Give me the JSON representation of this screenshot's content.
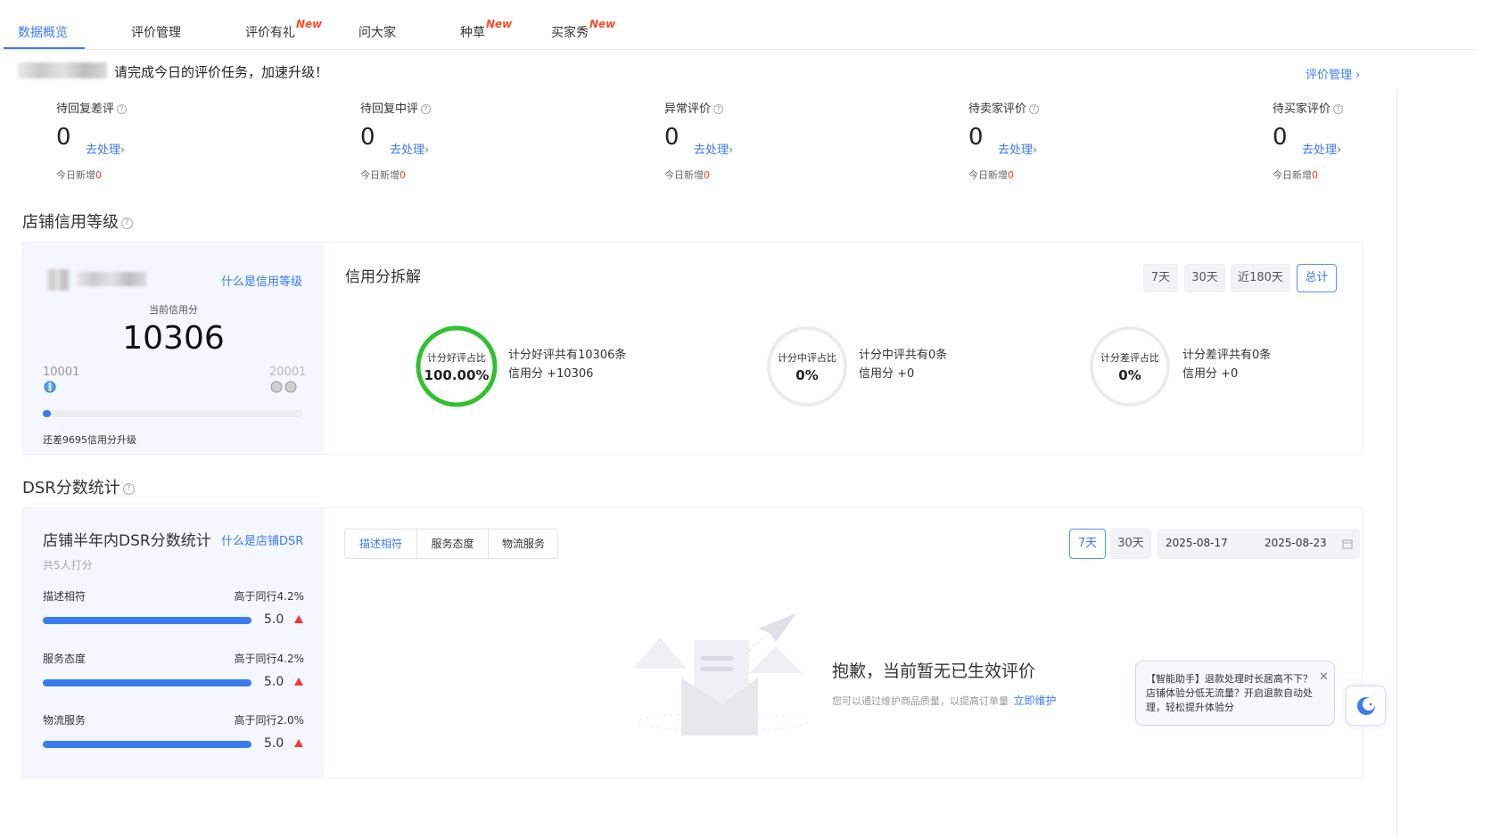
{
  "tabs": [
    {
      "label": "数据概览",
      "new": ""
    },
    {
      "label": "评价管理",
      "new": ""
    },
    {
      "label": "评价有礼",
      "new": "New"
    },
    {
      "label": "问大家",
      "new": ""
    },
    {
      "label": "种草",
      "new": "New"
    },
    {
      "label": "买家秀",
      "new": "New"
    }
  ],
  "banner": {
    "message": "请完成今日的评价任务，加速升级！",
    "link": "评价管理 ›"
  },
  "stats": [
    {
      "label": "待回复差评",
      "value": "0",
      "go": "去处理›",
      "today_label": "今日新增",
      "today_value": "0"
    },
    {
      "label": "待回复中评",
      "value": "0",
      "go": "去处理›",
      "today_label": "今日新增",
      "today_value": "0"
    },
    {
      "label": "异常评价",
      "value": "0",
      "go": "去处理›",
      "today_label": "今日新增",
      "today_value": "0"
    },
    {
      "label": "待卖家评价",
      "value": "0",
      "go": "去处理›",
      "today_label": "今日新增",
      "today_value": "0"
    },
    {
      "label": "待买家评价",
      "value": "0",
      "go": "去处理›",
      "today_label": "今日新增",
      "today_value": "0"
    }
  ],
  "credit": {
    "section_title": "店铺信用等级",
    "what_link": "什么是信用等级",
    "current_label": "当前信用分",
    "current_value": "10306",
    "min": "10001",
    "max": "20001",
    "progress_fraction": 0.03,
    "upgrade_text": "还差9695信用分升级",
    "breakdown_title": "信用分拆解",
    "ranges": [
      "7天",
      "30天",
      "近180天",
      "总计"
    ],
    "selected_range": "总计",
    "rings": [
      {
        "label": "计分好评占比",
        "value": "100.00%",
        "line1": "计分好评共有10306条",
        "line2": "信用分 +10306",
        "fraction": 1.0,
        "color": "#2fc12f"
      },
      {
        "label": "计分中评占比",
        "value": "0%",
        "line1": "计分中评共有0条",
        "line2": "信用分 +0",
        "fraction": 0,
        "color": "#2fc12f"
      },
      {
        "label": "计分差评占比",
        "value": "0%",
        "line1": "计分差评共有0条",
        "line2": "信用分 +0",
        "fraction": 0,
        "color": "#2fc12f"
      }
    ]
  },
  "dsr": {
    "section_title": "DSR分数统计",
    "card_title": "店铺半年内DSR分数统计",
    "what_link": "什么是店铺DSR",
    "raters": "共5人打分",
    "items": [
      {
        "name": "描述相符",
        "compare": "高于同行4.2%",
        "score": "5.0",
        "fraction": 1.0
      },
      {
        "name": "服务态度",
        "compare": "高于同行4.2%",
        "score": "5.0",
        "fraction": 1.0
      },
      {
        "name": "物流服务",
        "compare": "高于同行2.0%",
        "score": "5.0",
        "fraction": 1.0
      }
    ],
    "segments": [
      "描述相符",
      "服务态度",
      "物流服务"
    ],
    "selected_segment": "描述相符",
    "ranges": [
      "7天",
      "30天"
    ],
    "selected_range": "7天",
    "date_start": "2025-08-17",
    "date_end": "2025-08-23",
    "empty_title": "抱歉，当前暂无已生效评价",
    "empty_desc": "您可以通过维护商品质量，以提高订单量",
    "empty_link": "立即维护"
  },
  "assistant": {
    "text": "【智能助手】退款处理时长居高不下？店铺体验分低无流量？开启退款自动处理，轻松提升体验分"
  },
  "colors": {
    "accent": "#3b7bf0",
    "good": "#2fc12f",
    "alert": "#ff3333",
    "new_badge": "#ff4d2a"
  }
}
